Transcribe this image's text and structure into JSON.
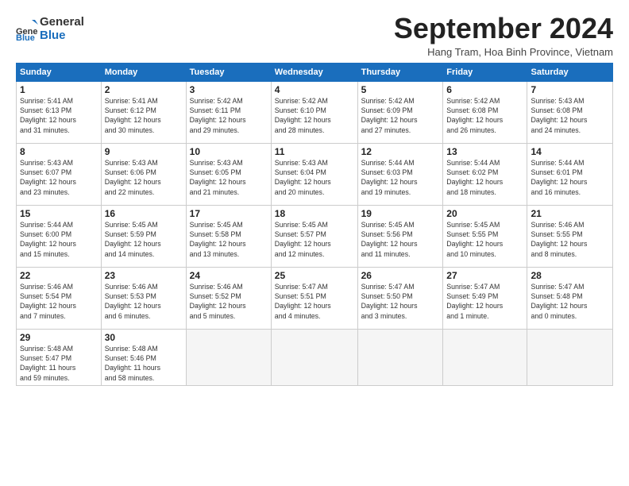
{
  "header": {
    "logo_line1": "General",
    "logo_line2": "Blue",
    "month_title": "September 2024",
    "subtitle": "Hang Tram, Hoa Binh Province, Vietnam"
  },
  "weekdays": [
    "Sunday",
    "Monday",
    "Tuesday",
    "Wednesday",
    "Thursday",
    "Friday",
    "Saturday"
  ],
  "weeks": [
    [
      {
        "day": "1",
        "info": "Sunrise: 5:41 AM\nSunset: 6:13 PM\nDaylight: 12 hours\nand 31 minutes."
      },
      {
        "day": "2",
        "info": "Sunrise: 5:41 AM\nSunset: 6:12 PM\nDaylight: 12 hours\nand 30 minutes."
      },
      {
        "day": "3",
        "info": "Sunrise: 5:42 AM\nSunset: 6:11 PM\nDaylight: 12 hours\nand 29 minutes."
      },
      {
        "day": "4",
        "info": "Sunrise: 5:42 AM\nSunset: 6:10 PM\nDaylight: 12 hours\nand 28 minutes."
      },
      {
        "day": "5",
        "info": "Sunrise: 5:42 AM\nSunset: 6:09 PM\nDaylight: 12 hours\nand 27 minutes."
      },
      {
        "day": "6",
        "info": "Sunrise: 5:42 AM\nSunset: 6:08 PM\nDaylight: 12 hours\nand 26 minutes."
      },
      {
        "day": "7",
        "info": "Sunrise: 5:43 AM\nSunset: 6:08 PM\nDaylight: 12 hours\nand 24 minutes."
      }
    ],
    [
      {
        "day": "8",
        "info": "Sunrise: 5:43 AM\nSunset: 6:07 PM\nDaylight: 12 hours\nand 23 minutes."
      },
      {
        "day": "9",
        "info": "Sunrise: 5:43 AM\nSunset: 6:06 PM\nDaylight: 12 hours\nand 22 minutes."
      },
      {
        "day": "10",
        "info": "Sunrise: 5:43 AM\nSunset: 6:05 PM\nDaylight: 12 hours\nand 21 minutes."
      },
      {
        "day": "11",
        "info": "Sunrise: 5:43 AM\nSunset: 6:04 PM\nDaylight: 12 hours\nand 20 minutes."
      },
      {
        "day": "12",
        "info": "Sunrise: 5:44 AM\nSunset: 6:03 PM\nDaylight: 12 hours\nand 19 minutes."
      },
      {
        "day": "13",
        "info": "Sunrise: 5:44 AM\nSunset: 6:02 PM\nDaylight: 12 hours\nand 18 minutes."
      },
      {
        "day": "14",
        "info": "Sunrise: 5:44 AM\nSunset: 6:01 PM\nDaylight: 12 hours\nand 16 minutes."
      }
    ],
    [
      {
        "day": "15",
        "info": "Sunrise: 5:44 AM\nSunset: 6:00 PM\nDaylight: 12 hours\nand 15 minutes."
      },
      {
        "day": "16",
        "info": "Sunrise: 5:45 AM\nSunset: 5:59 PM\nDaylight: 12 hours\nand 14 minutes."
      },
      {
        "day": "17",
        "info": "Sunrise: 5:45 AM\nSunset: 5:58 PM\nDaylight: 12 hours\nand 13 minutes."
      },
      {
        "day": "18",
        "info": "Sunrise: 5:45 AM\nSunset: 5:57 PM\nDaylight: 12 hours\nand 12 minutes."
      },
      {
        "day": "19",
        "info": "Sunrise: 5:45 AM\nSunset: 5:56 PM\nDaylight: 12 hours\nand 11 minutes."
      },
      {
        "day": "20",
        "info": "Sunrise: 5:45 AM\nSunset: 5:55 PM\nDaylight: 12 hours\nand 10 minutes."
      },
      {
        "day": "21",
        "info": "Sunrise: 5:46 AM\nSunset: 5:55 PM\nDaylight: 12 hours\nand 8 minutes."
      }
    ],
    [
      {
        "day": "22",
        "info": "Sunrise: 5:46 AM\nSunset: 5:54 PM\nDaylight: 12 hours\nand 7 minutes."
      },
      {
        "day": "23",
        "info": "Sunrise: 5:46 AM\nSunset: 5:53 PM\nDaylight: 12 hours\nand 6 minutes."
      },
      {
        "day": "24",
        "info": "Sunrise: 5:46 AM\nSunset: 5:52 PM\nDaylight: 12 hours\nand 5 minutes."
      },
      {
        "day": "25",
        "info": "Sunrise: 5:47 AM\nSunset: 5:51 PM\nDaylight: 12 hours\nand 4 minutes."
      },
      {
        "day": "26",
        "info": "Sunrise: 5:47 AM\nSunset: 5:50 PM\nDaylight: 12 hours\nand 3 minutes."
      },
      {
        "day": "27",
        "info": "Sunrise: 5:47 AM\nSunset: 5:49 PM\nDaylight: 12 hours\nand 1 minute."
      },
      {
        "day": "28",
        "info": "Sunrise: 5:47 AM\nSunset: 5:48 PM\nDaylight: 12 hours\nand 0 minutes."
      }
    ],
    [
      {
        "day": "29",
        "info": "Sunrise: 5:48 AM\nSunset: 5:47 PM\nDaylight: 11 hours\nand 59 minutes."
      },
      {
        "day": "30",
        "info": "Sunrise: 5:48 AM\nSunset: 5:46 PM\nDaylight: 11 hours\nand 58 minutes."
      },
      {
        "day": "",
        "info": ""
      },
      {
        "day": "",
        "info": ""
      },
      {
        "day": "",
        "info": ""
      },
      {
        "day": "",
        "info": ""
      },
      {
        "day": "",
        "info": ""
      }
    ]
  ]
}
